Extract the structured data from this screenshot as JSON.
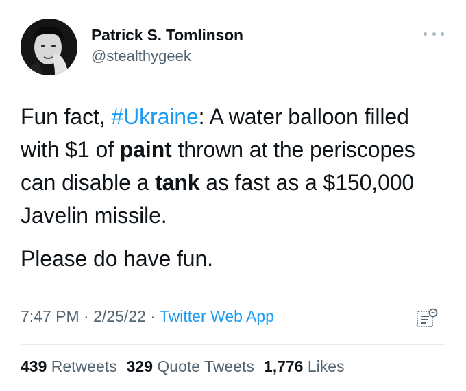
{
  "author": {
    "display_name": "Patrick S. Tomlinson",
    "handle": "@stealthygeek",
    "avatar_icon": "user-avatar-photo"
  },
  "tweet": {
    "segments": [
      {
        "text": "Fun fact, "
      },
      {
        "text": "#Ukraine",
        "style": "hashtag"
      },
      {
        "text": ": A water balloon filled with $1 of "
      },
      {
        "text": "paint",
        "style": "bold"
      },
      {
        "text": " thrown at the periscopes can disable a "
      },
      {
        "text": "tank",
        "style": "bold"
      },
      {
        "text": " as fast as a $150,000 Javelin missile."
      }
    ],
    "second_paragraph": "Please do have fun."
  },
  "meta": {
    "time": "7:47 PM",
    "separator": "·",
    "date": "2/25/22",
    "source": "Twitter Web App"
  },
  "stats": {
    "retweets_count": "439",
    "retweets_label": "Retweets",
    "quotes_count": "329",
    "quotes_label": "Quote Tweets",
    "likes_count": "1,776",
    "likes_label": "Likes"
  },
  "icons": {
    "more": "more-options-icon",
    "analytics": "tweet-analytics-icon"
  },
  "colors": {
    "text": "#0f1419",
    "secondary": "#536471",
    "link": "#1d9bf0",
    "divider": "#e6ecf0"
  }
}
